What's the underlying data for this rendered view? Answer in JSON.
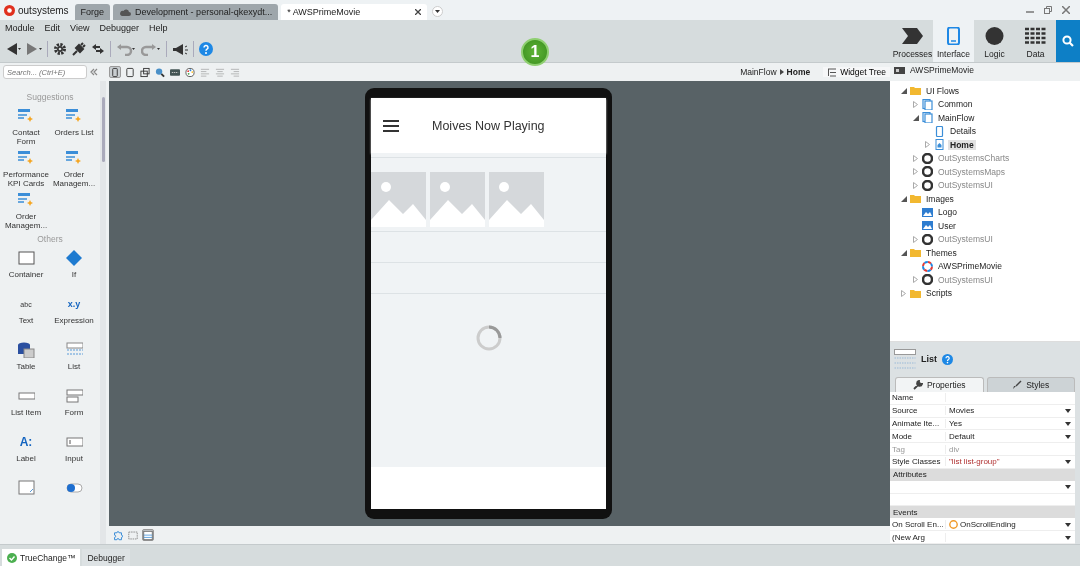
{
  "window": {
    "logo": "outsystems",
    "tabs": [
      {
        "label": "Forge",
        "selected": false,
        "kind": "plain"
      },
      {
        "label": "Development - personal-qkexydt...",
        "selected": false,
        "kind": "cloud"
      },
      {
        "label": "* AWSPrimeMovie",
        "selected": true,
        "kind": "closable"
      }
    ]
  },
  "menu": [
    "Module",
    "Edit",
    "View",
    "Debugger",
    "Help"
  ],
  "publish_badge": "1",
  "workspace_tabs": [
    {
      "label": "Processes",
      "selected": false,
      "kind": "processes"
    },
    {
      "label": "Interface",
      "selected": true,
      "kind": "interface"
    },
    {
      "label": "Logic",
      "selected": false,
      "kind": "logic"
    },
    {
      "label": "Data",
      "selected": false,
      "kind": "data"
    }
  ],
  "toolbox": {
    "search": {
      "placeholder": "Search... (Ctrl+E)"
    },
    "sections": [
      {
        "title": "Suggestions",
        "items": [
          {
            "label": "Contact Form",
            "kind": "suggestion"
          },
          {
            "label": "Orders List",
            "kind": "suggestion"
          },
          {
            "label": "Performance KPI Cards",
            "kind": "suggestion"
          },
          {
            "label": "Order Managem...",
            "kind": "suggestion"
          },
          {
            "label": "Order Managem...",
            "kind": "suggestion"
          }
        ]
      },
      {
        "title": "Others",
        "items": [
          {
            "label": "Container",
            "kind": "container"
          },
          {
            "label": "If",
            "kind": "if"
          },
          {
            "label": "Text",
            "kind": "text",
            "glyph": "abc"
          },
          {
            "label": "Expression",
            "kind": "expression",
            "glyph": "x.y"
          },
          {
            "label": "Table",
            "kind": "table"
          },
          {
            "label": "List",
            "kind": "list"
          },
          {
            "label": "List Item",
            "kind": "listitem"
          },
          {
            "label": "Form",
            "kind": "form"
          },
          {
            "label": "Label",
            "kind": "label",
            "glyph": "A:"
          },
          {
            "label": "Input",
            "kind": "input"
          },
          {
            "kind": "textarea"
          },
          {
            "kind": "switch"
          }
        ]
      }
    ]
  },
  "canvas_toolbar": [
    {
      "kind": "phone",
      "selected": true,
      "disabled": false
    },
    {
      "kind": "tablet",
      "selected": false,
      "disabled": false
    },
    {
      "kind": "rotate",
      "selected": false,
      "disabled": false
    },
    {
      "kind": "preview",
      "selected": false,
      "disabled": false
    },
    {
      "kind": "css",
      "selected": false,
      "disabled": false
    },
    {
      "kind": "palette",
      "selected": false,
      "disabled": false
    },
    {
      "kind": "align-left",
      "selected": false,
      "disabled": true
    },
    {
      "kind": "align-center",
      "selected": false,
      "disabled": true
    },
    {
      "kind": "align-right",
      "selected": false,
      "disabled": true
    }
  ],
  "breadcrumb": [
    "MainFlow",
    "Home"
  ],
  "screen": {
    "title": "Moives Now Playing"
  },
  "canvas_bottom_toolbar": [
    {
      "kind": "widgets",
      "selected": false
    },
    {
      "kind": "select-area",
      "selected": false
    },
    {
      "kind": "layout",
      "selected": true
    }
  ],
  "tree": {
    "tab": "Widget Tree",
    "root": {
      "label": "AWSPrimeMovie"
    },
    "items": [
      {
        "label": "UI Flows",
        "kind": "folder",
        "expanded": true,
        "dimmed": false,
        "selected": false,
        "children": [
          {
            "label": "Common",
            "kind": "flow",
            "expanded": false,
            "dimmed": false,
            "selected": false
          },
          {
            "label": "MainFlow",
            "kind": "flow",
            "expanded": true,
            "dimmed": false,
            "selected": false,
            "children": [
              {
                "label": "Details",
                "kind": "screen",
                "dimmed": false,
                "selected": false
              },
              {
                "label": "Home",
                "kind": "home-screen",
                "expanded": false,
                "dimmed": false,
                "selected": true
              }
            ]
          },
          {
            "label": "OutSystemsCharts",
            "kind": "module",
            "expanded": false,
            "dimmed": true,
            "selected": false
          },
          {
            "label": "OutSystemsMaps",
            "kind": "module",
            "expanded": false,
            "dimmed": true,
            "selected": false
          },
          {
            "label": "OutSystemsUI",
            "kind": "module",
            "expanded": false,
            "dimmed": true,
            "selected": false
          }
        ]
      },
      {
        "label": "Images",
        "kind": "folder",
        "expanded": true,
        "dimmed": false,
        "selected": false,
        "children": [
          {
            "label": "Logo",
            "kind": "image",
            "dimmed": false,
            "selected": false
          },
          {
            "label": "User",
            "kind": "image",
            "dimmed": false,
            "selected": false
          },
          {
            "label": "OutSystemsUI",
            "kind": "module",
            "expanded": false,
            "dimmed": true,
            "selected": false
          }
        ]
      },
      {
        "label": "Themes",
        "kind": "folder",
        "expanded": true,
        "dimmed": false,
        "selected": false,
        "children": [
          {
            "label": "AWSPrimeMovie",
            "kind": "theme",
            "dimmed": false,
            "selected": false
          },
          {
            "label": "OutSystemsUI",
            "kind": "module",
            "expanded": false,
            "dimmed": true,
            "selected": false
          }
        ]
      },
      {
        "label": "Scripts",
        "kind": "folder",
        "expanded": false,
        "dimmed": false,
        "selected": false
      }
    ]
  },
  "properties": {
    "widget": "List",
    "tabs": [
      {
        "label": "Properties",
        "selected": true,
        "kind": "wrench"
      },
      {
        "label": "Styles",
        "selected": false,
        "kind": "brush"
      }
    ],
    "rows": [
      {
        "kind": "text",
        "name": "Name",
        "dropdown": false
      },
      {
        "kind": "text",
        "name": "Source",
        "value": "Movies",
        "dropdown": true
      },
      {
        "kind": "text",
        "name": "Animate Ite...",
        "value": "Yes",
        "dropdown": true
      },
      {
        "kind": "text",
        "name": "Mode",
        "value": "Default",
        "dropdown": true
      },
      {
        "kind": "readonly",
        "name": "Tag",
        "value": "div",
        "dropdown": false
      },
      {
        "kind": "string",
        "name": "Style Classes",
        "value": "\"list list-group\"",
        "dropdown": true
      },
      {
        "kind": "section",
        "name": "Attributes"
      },
      {
        "kind": "text",
        "dropdown": true
      },
      {
        "kind": "text",
        "dropdown": false
      },
      {
        "kind": "section",
        "name": "Events"
      },
      {
        "kind": "action",
        "name": "On Scroll En...",
        "value": "OnScrollEnding",
        "dropdown": true
      },
      {
        "kind": "text",
        "name": "(New Arg",
        "dropdown": true
      }
    ]
  },
  "status_bar": [
    {
      "label": "TrueChange™",
      "kind": "ok"
    },
    {
      "label": "Debugger",
      "kind": "plain"
    }
  ]
}
